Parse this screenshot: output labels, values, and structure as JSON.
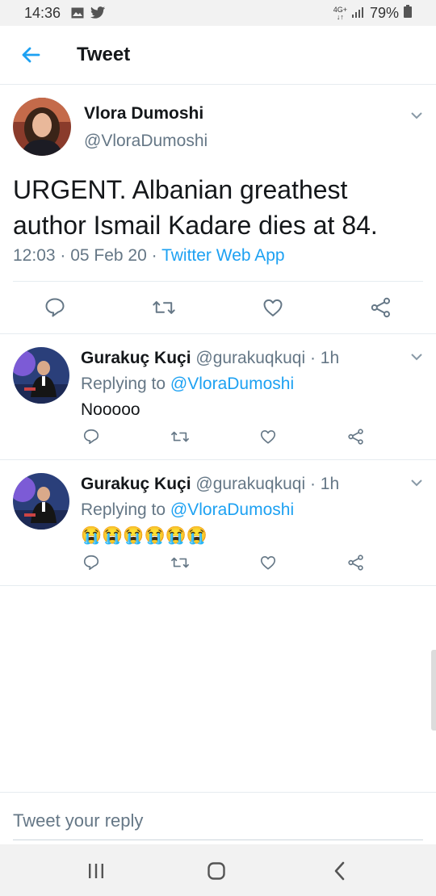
{
  "status_bar": {
    "time": "14:36",
    "network_top": "4G+",
    "network_bottom": "↓↑",
    "battery": "79%"
  },
  "header": {
    "title": "Tweet"
  },
  "main_tweet": {
    "name": "Vlora Dumoshi",
    "handle": "@VloraDumoshi",
    "text": "URGENT. Albanian greathest author Ismail Kadare dies at 84.",
    "time": "12:03 · 05 Feb 20 · ",
    "source": "Twitter Web App"
  },
  "replies": [
    {
      "name": "Gurakuç Kuçi",
      "meta": " @gurakuqkuqi · 1h",
      "replying_prefix": "Replying to ",
      "mention": "@VloraDumoshi",
      "text": "Nooooo"
    },
    {
      "name": "Gurakuç Kuçi",
      "meta": " @gurakuqkuqi · 1h",
      "replying_prefix": "Replying to ",
      "mention": "@VloraDumoshi",
      "text": "😭😭😭😭😭😭"
    }
  ],
  "composer": {
    "placeholder": "Tweet your reply"
  },
  "colors": {
    "accent": "#1da1f2",
    "secondary_text": "#657786",
    "divider": "#e6ecf0"
  }
}
